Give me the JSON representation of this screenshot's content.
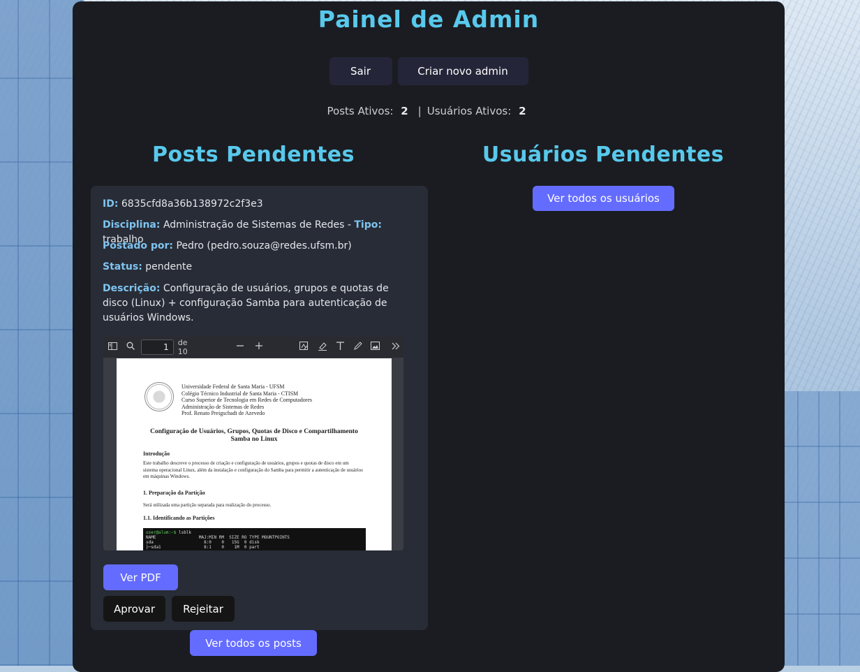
{
  "title": "Painel de Admin",
  "top_buttons": {
    "logout": "Sair",
    "create_admin": "Criar novo admin"
  },
  "stats": {
    "posts_label": "Posts Ativos:",
    "posts_value": "2",
    "separator": "|",
    "users_label": "Usuários Ativos:",
    "users_value": "2"
  },
  "posts_section": {
    "heading": "Posts Pendentes",
    "post": {
      "id_label": "ID:",
      "id_value": "6835cfd8a36b138972c2f3e3",
      "discipline_label": "Disciplina:",
      "discipline_value": "Administração de Sistemas de Redes",
      "dash": "-",
      "type_label": "Tipo:",
      "type_value": "trabalho",
      "posted_by_label": "Postado por:",
      "posted_by_value": "Pedro (pedro.souza@redes.ufsm.br)",
      "status_label": "Status:",
      "status_value": "pendente",
      "description_label": "Descrição:",
      "description_value": "Configuração de usuários, grupos e quotas de disco (Linux) + configuração Samba para autenticação de usuários Windows."
    },
    "viewer": {
      "page_input": "1",
      "page_total": "de 10",
      "pdf": {
        "header_lines": [
          "Universidade Federal de Santa Maria - UFSM",
          "Colégio Técnico Industrial de Santa Maria - CTISM",
          "Curso Superior de Tecnologia em Redes de Computadores",
          "Administração de Sistemas de Redes",
          "Prof. Renato Preigschadt de Azevedo"
        ],
        "doc_title_1": "Configuração de Usuários, Grupos, Quotas de Disco e Compartilhamento",
        "doc_title_2": "Samba no Linux",
        "intro_heading": "Introdução",
        "intro_text": "Este trabalho descreve o processo de criação e configuração de usuários, grupos e quotas de disco em um sistema operacional Linux, além da instalação e configuração do Samba para permitir a autenticação de usuários em máquinas Windows.",
        "sec1_heading": "1. Preparação da Partição",
        "sec1_text": "Será utilizada uma partição separada para realização do processo.",
        "sec11_heading": "1.1. Identificando as Partições",
        "term_prompt": "user@alum:~$",
        "term_cmd": " lsblk",
        "term_lines": [
          "NAME                 MAJ:MIN RM  SIZE RO TYPE MOUNTPOINTS",
          "sda                    8:0    0   15G  0 disk",
          "├─sda1                 8:1    0    1M  0 part"
        ]
      }
    },
    "view_pdf": "Ver PDF",
    "approve": "Aprovar",
    "reject": "Rejeitar",
    "see_all_posts": "Ver todos os posts"
  },
  "users_section": {
    "heading": "Usuários Pendentes",
    "see_all_users": "Ver todos os usuários"
  },
  "colors": {
    "accent": "#646cff",
    "heading": "#58c9ec",
    "label": "#7fc4f0",
    "panel_bg": "#1b1c21",
    "card_bg": "#282c36"
  }
}
